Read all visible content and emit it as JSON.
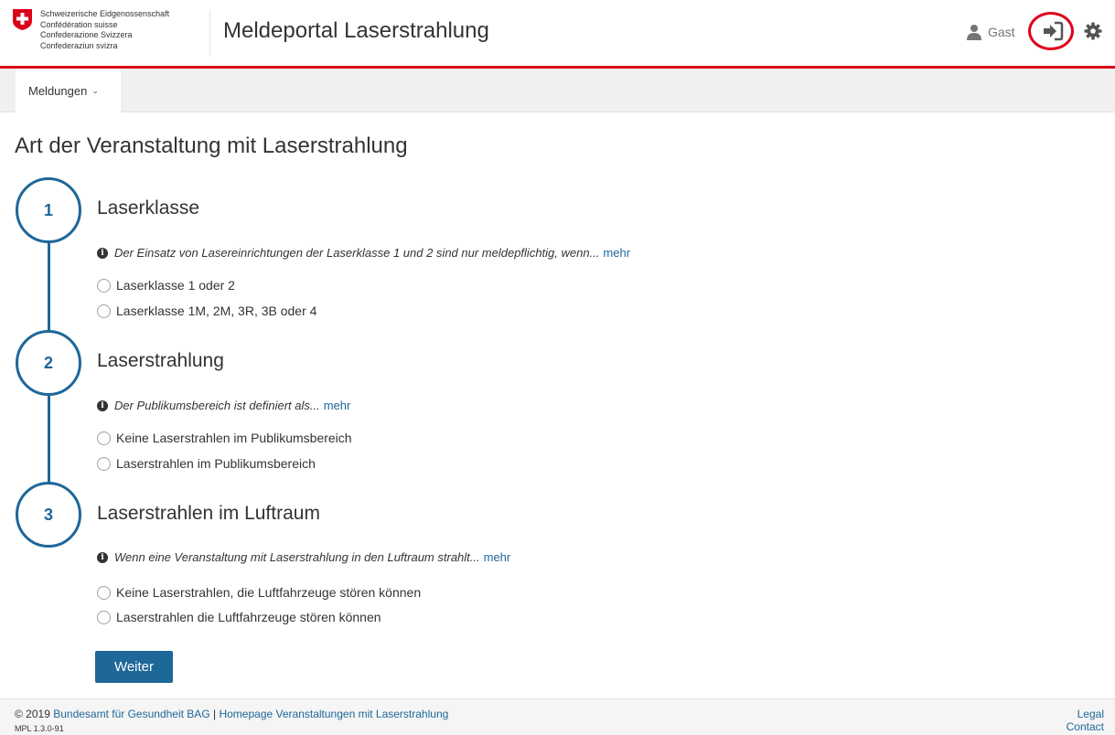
{
  "header": {
    "logo_lines": [
      "Schweizerische Eidgenossenschaft",
      "Confédération suisse",
      "Confederazione Svizzera",
      "Confederaziun svizra"
    ],
    "app_title": "Meldeportal Laserstrahlung",
    "user_name": "Gast"
  },
  "nav": {
    "menu_label": "Meldungen"
  },
  "main": {
    "page_title": "Art der Veranstaltung mit Laserstrahlung",
    "steps": [
      {
        "number": "1",
        "title": "Laserklasse",
        "info": "Der Einsatz von Lasereinrichtungen der Laserklasse 1 und 2 sind nur meldepflichtig, wenn...",
        "more": "mehr",
        "options": [
          "Laserklasse 1 oder 2",
          "Laserklasse 1M, 2M, 3R, 3B oder 4"
        ]
      },
      {
        "number": "2",
        "title": "Laserstrahlung",
        "info": "Der Publikumsbereich ist definiert als...",
        "more": "mehr",
        "options": [
          "Keine Laserstrahlen im Publikumsbereich",
          "Laserstrahlen im Publikumsbereich"
        ]
      },
      {
        "number": "3",
        "title": "Laserstrahlen im Luftraum",
        "info": "Wenn eine Veranstaltung mit Laserstrahlung in den Luftraum strahlt...",
        "more": "mehr",
        "options": [
          "Keine Laserstrahlen, die Luftfahrzeuge stören können",
          "Laserstrahlen die Luftfahrzeuge stören können"
        ]
      }
    ],
    "next_button": "Weiter"
  },
  "footer": {
    "copyright": "© 2019",
    "bag_link": "Bundesamt für Gesundheit BAG",
    "separator": "|",
    "homepage_link": "Homepage Veranstaltungen mit Laserstrahlung",
    "version": "MPL 1.3.0-91",
    "legal": "Legal",
    "contact": "Contact"
  },
  "colors": {
    "brand_red": "#dc0018",
    "accent_blue": "#1e6799"
  }
}
